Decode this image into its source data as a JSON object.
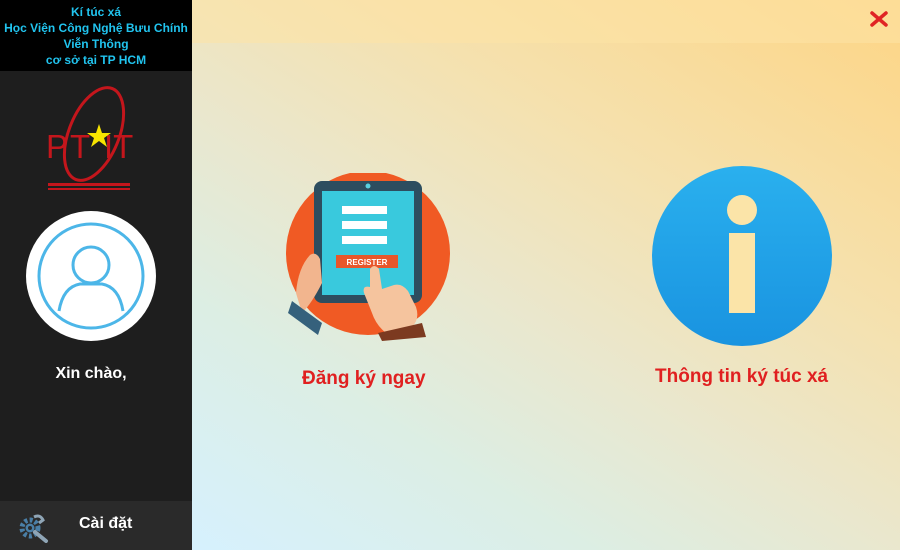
{
  "sidebar": {
    "header_lines": [
      "Kí túc xá",
      "Học Viện Công Nghệ Bưu Chính",
      "Viễn Thông",
      "cơ sở tại TP HCM"
    ],
    "logo_text": "PTIT",
    "logo_icon": "ptit-logo-icon",
    "avatar_icon": "user-avatar-icon",
    "greeting": "Xin chào,",
    "settings": {
      "label": "Cài đặt",
      "icon": "gear-wrench-icon"
    }
  },
  "window": {
    "close_icon": "close-x-icon"
  },
  "main": {
    "register": {
      "label": "Đăng ký ngay",
      "icon": "tablet-register-icon",
      "screen_button_text": "REGISTER"
    },
    "info": {
      "label": "Thông tin ký túc xá",
      "icon": "info-circle-icon"
    }
  },
  "colors": {
    "sidebar_bg": "#1e1e1e",
    "header_text": "#21c4ef",
    "accent_red": "#e02020",
    "register_circle": "#f05a24",
    "info_circle": "#1e9de6"
  }
}
